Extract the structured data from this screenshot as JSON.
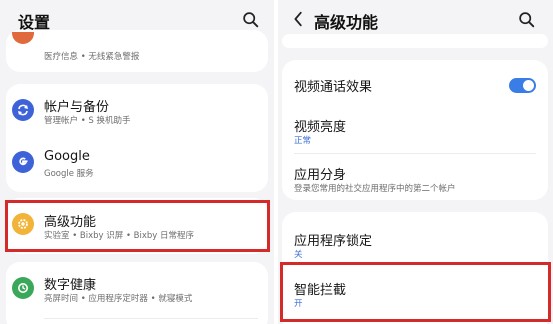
{
  "left": {
    "title": "设置",
    "partial_item_subtitle": "医疗信息 • 无线紧急警报",
    "items": [
      {
        "label": "帐户与备份",
        "subtitle": "管理帐户 • S 换机助手",
        "icon": "sync-icon",
        "color": "#3e63d8"
      },
      {
        "label": "Google",
        "subtitle": "Google 服务",
        "icon": "google-icon",
        "color": "#3e63d8"
      },
      {
        "label": "高级功能",
        "subtitle": "实验室 • Bixby 识屏 • Bixby 日常程序",
        "icon": "gear-plus-icon",
        "color": "#f1b338"
      },
      {
        "label": "数字健康",
        "subtitle": "亮屏时间 • 应用程序定时器 • 就寝模式",
        "icon": "wellbeing-icon",
        "color": "#3aa85a"
      }
    ]
  },
  "right": {
    "title": "高级功能",
    "items": [
      {
        "label": "视频通话效果",
        "toggle": true
      },
      {
        "label": "视频亮度",
        "subtitle": "正常"
      },
      {
        "label": "应用分身",
        "subtitle": "登录您常用的社交应用程序中的第二个帐户"
      },
      {
        "label": "应用程序锁定",
        "subtitle": "关"
      },
      {
        "label": "智能拦截",
        "subtitle": "开"
      }
    ]
  },
  "colors": {
    "highlight": "#d42a2a",
    "accent": "#3b7de6",
    "panel_bg": "#f4f4f6"
  }
}
